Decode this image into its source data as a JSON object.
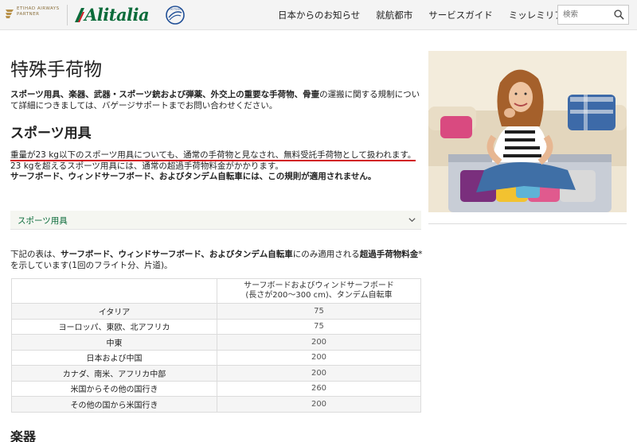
{
  "header": {
    "etihad_logo_text": "ETIHAD AIRWAYS PARTNER",
    "brand": "Alitalia",
    "skyteam_logo_text": "SKYTEAM",
    "nav": [
      "日本からのお知らせ",
      "就航都市",
      "サービスガイド",
      "ミッレミリア"
    ],
    "search_placeholder": "検索"
  },
  "main": {
    "title": "特殊手荷物",
    "intro": {
      "bold1": "スポーツ用具、楽器、武器・スポーツ銃および弾薬、外交上の重要な手荷物、骨壷",
      "rest": "の運搬に関する規制について詳細につきましては、バゲージサポートまでお問い合わせください。"
    },
    "sports": {
      "heading": "スポーツ用具",
      "underlined": "重量が23 kg以下のスポーツ用具についても、通常の手荷物と見なされ、無料受託手荷物として扱われます。",
      "rest": " 23 kgを超えるスポーツ用具には、通常の超過手荷物料金がかかります。",
      "bold_line": "サーフボード、ウィンドサーフボード、およびタンデム自転車には、この規則が適用されません。"
    },
    "accordion_label": "スポーツ用具",
    "table_intro": {
      "p1": "下記の表は、",
      "b1": "サーフボード、ウィンドサーフボード、およびタンデム自転車",
      "p2": "にのみ適用される",
      "b2": "超過手荷物料金",
      "p3": "*を示しています(1回のフライト分、片道)。"
    },
    "table": {
      "header_col1": "",
      "header_col2": "サーフボードおよびウィンドサーフボード(長さが200～300 cm)、タンデム自転車",
      "rows": [
        {
          "region": "イタリア",
          "fee": "75"
        },
        {
          "region": "ヨーロッパ、東欧、北アフリカ",
          "fee": "75"
        },
        {
          "region": "中東",
          "fee": "200"
        },
        {
          "region": "日本および中国",
          "fee": "200"
        },
        {
          "region": "カナダ、南米、アフリカ中部",
          "fee": "200"
        },
        {
          "region": "米国からその他の国行き",
          "fee": "260"
        },
        {
          "region": "その他の国から米国行き",
          "fee": "200"
        }
      ]
    },
    "next_heading": "楽器"
  },
  "colors": {
    "brand_green": "#0b6b3a",
    "underline_red": "#d2141e",
    "accordion_bg": "#f5f6f1",
    "header_bg": "#f4f4f4"
  },
  "icons": [
    "etihad-icon",
    "skyteam-icon",
    "search-icon",
    "chevron-down-icon"
  ]
}
